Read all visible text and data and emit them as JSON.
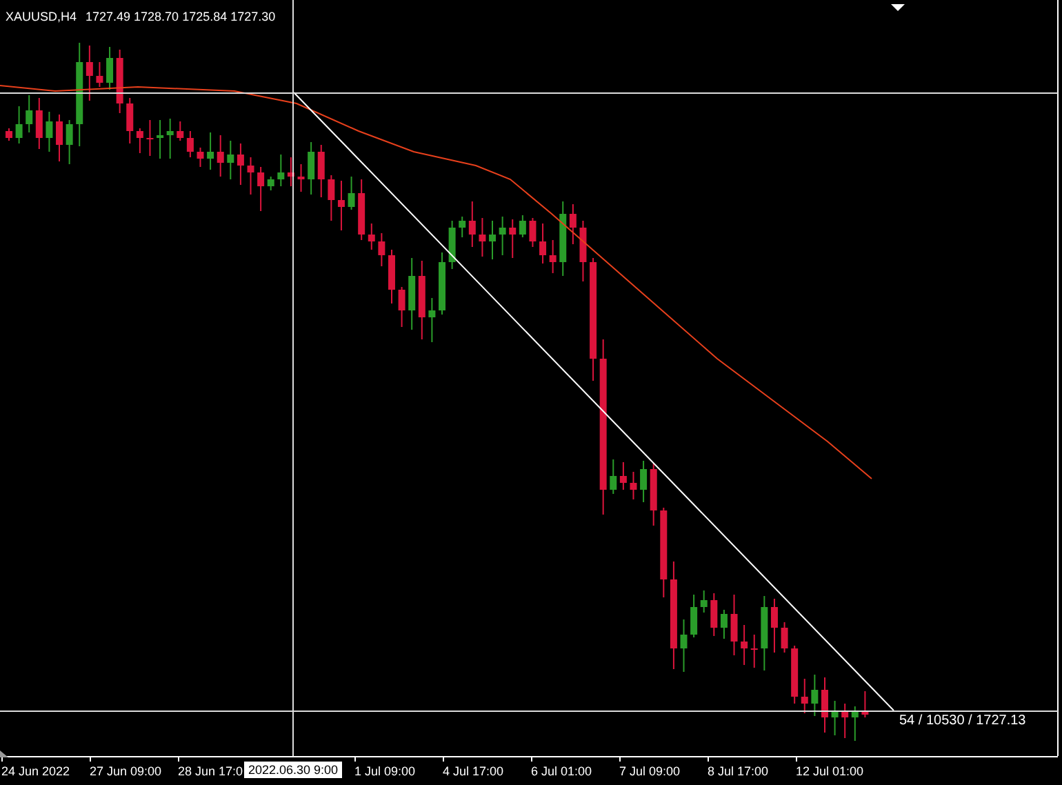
{
  "symbol_header": {
    "symbol": "XAUUSD,H4",
    "ohlc": "1727.49 1728.70 1725.84 1727.30"
  },
  "x_axis": {
    "labels": [
      "24 Jun 2022",
      "27 Jun 09:00",
      "28 Jun 17:0",
      "1 Jul 09:00",
      "4 Jul 17:00",
      "6 Jul 01:00",
      "7 Jul 09:00",
      "8 Jul 17:00",
      "12 Jul 01:00"
    ]
  },
  "crosshair": {
    "time_label": "2022.06.30 9:00",
    "readout": "54 / 10530 / 1727.13"
  }
}
